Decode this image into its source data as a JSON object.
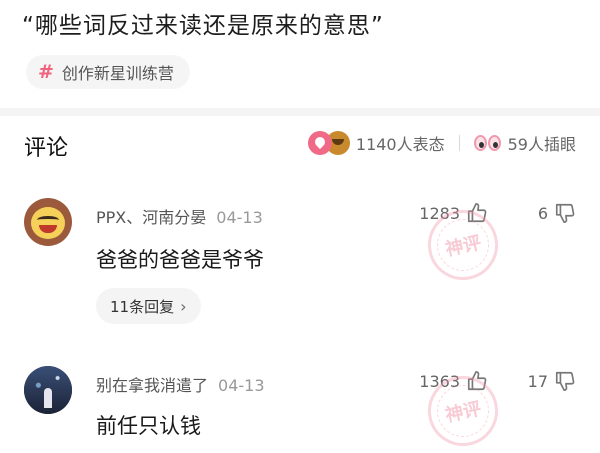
{
  "post": {
    "title": "“哪些词反过来读还是原来的意思”"
  },
  "topic_tag": {
    "symbol": "#",
    "label": "创作新星训练营"
  },
  "comments_header": {
    "label": "评论",
    "reactions_text": "1140人表态",
    "insert_eyes_text": "59人插眼"
  },
  "comments": [
    {
      "user": "PPX、河南分晏",
      "date": "04-13",
      "text": "爸爸的爸爸是爷爷",
      "likes": "1283",
      "dislikes": "6",
      "replies_label": "11条回复"
    },
    {
      "user": "别在拿我消遣了",
      "date": "04-13",
      "text": "前任只认钱",
      "likes": "1363",
      "dislikes": "17"
    }
  ],
  "stamp_text": "神评",
  "colors": {
    "accent": "#f0627d",
    "text_primary": "#1a1a1a",
    "text_secondary": "#666666",
    "divider": "#f4f4f4"
  }
}
